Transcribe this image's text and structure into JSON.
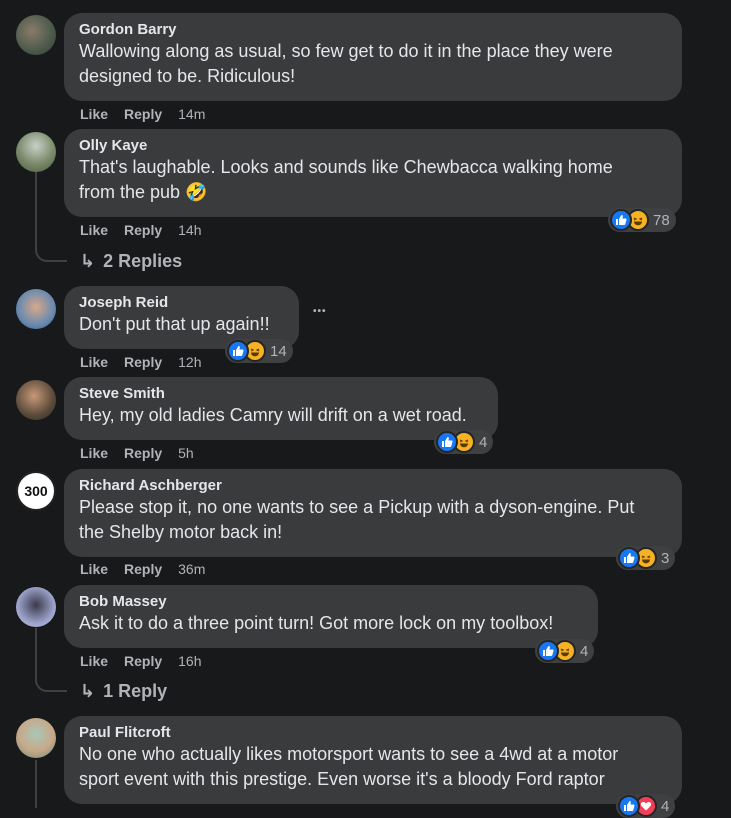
{
  "comments": [
    {
      "author": "Gordon Barry",
      "lines": [
        "Wallowing along as usual, so few get to do it in the place they were",
        "designed to be. Ridiculous!"
      ],
      "like": "Like",
      "reply": "Reply",
      "time": "14m"
    },
    {
      "author": "Olly Kaye",
      "lines": [
        "That's laughable. Looks and sounds like Chewbacca walking home",
        "from the pub 🤣"
      ],
      "like": "Like",
      "reply": "Reply",
      "time": "14h",
      "reactions": "78",
      "replies": "2 Replies"
    },
    {
      "author": "Joseph Reid",
      "lines": [
        "Don't put that up again!!"
      ],
      "like": "Like",
      "reply": "Reply",
      "time": "12h",
      "reactions": "14"
    },
    {
      "author": "Steve Smith",
      "lines": [
        "Hey, my old ladies Camry will drift on a wet road."
      ],
      "like": "Like",
      "reply": "Reply",
      "time": "5h",
      "reactions": "4"
    },
    {
      "author": "Richard Aschberger",
      "lines": [
        "Please stop it, no one wants to see a Pickup with a dyson-engine. Put",
        "the Shelby motor back in!"
      ],
      "like": "Like",
      "reply": "Reply",
      "time": "36m",
      "reactions": "3",
      "avatar_text": "300"
    },
    {
      "author": "Bob Massey",
      "lines": [
        "Ask it to do a three point turn! Got more lock on my toolbox!"
      ],
      "like": "Like",
      "reply": "Reply",
      "time": "16h",
      "reactions": "4",
      "replies": "1 Reply"
    },
    {
      "author": "Paul Flitcroft",
      "lines": [
        "No one who actually likes motorsport wants to see a 4wd at a motor",
        "sport event with this prestige. Even worse it's a bloody Ford raptor"
      ],
      "reactions": "4"
    }
  ],
  "more_glyph": "•••",
  "reply_arrow": "↳",
  "colors": {
    "bubble": "#3a3b3c",
    "like": "#1877f2",
    "haha": "#f7b125",
    "love": "#f33e58",
    "bg": "#18191a"
  }
}
